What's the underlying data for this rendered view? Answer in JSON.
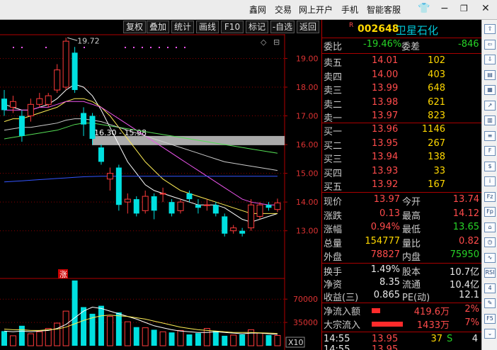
{
  "menu": {
    "items": [
      "鑫网",
      "交易",
      "网上开户",
      "手机",
      "智能客服"
    ],
    "win_controls": [
      "shirt-icon",
      "minimize-icon",
      "restore-icon",
      "close-icon"
    ]
  },
  "toolbar": {
    "buttons": [
      "复权",
      "叠加",
      "统计",
      "画线",
      "F10",
      "标记",
      "-自选",
      "返回"
    ]
  },
  "stock": {
    "flag": "R",
    "code": "002648",
    "name": "卫星石化"
  },
  "quote": {
    "weibi_label": "委比",
    "weibi_value": "-19.46%",
    "weicha_label": "委差",
    "weicha_value": "-846",
    "asks": [
      {
        "label": "卖五",
        "price": "14.01",
        "vol": "102"
      },
      {
        "label": "卖四",
        "price": "14.00",
        "vol": "403"
      },
      {
        "label": "卖三",
        "price": "13.99",
        "vol": "648"
      },
      {
        "label": "卖二",
        "price": "13.98",
        "vol": "621"
      },
      {
        "label": "卖一",
        "price": "13.97",
        "vol": "823"
      }
    ],
    "bids": [
      {
        "label": "买一",
        "price": "13.96",
        "vol": "1146"
      },
      {
        "label": "买二",
        "price": "13.95",
        "vol": "267"
      },
      {
        "label": "买三",
        "price": "13.94",
        "vol": "138"
      },
      {
        "label": "买四",
        "price": "13.93",
        "vol": "33"
      },
      {
        "label": "买五",
        "price": "13.92",
        "vol": "167"
      }
    ],
    "stats": [
      {
        "l1": "现价",
        "v1": "13.97",
        "l2": "今开",
        "v2": "13.74"
      },
      {
        "l1": "涨跌",
        "v1": "0.13",
        "l2": "最高",
        "v2": "14.12"
      },
      {
        "l1": "涨幅",
        "v1": "0.94%",
        "l2": "最低",
        "v2": "13.65"
      },
      {
        "l1": "总量",
        "v1": "154777",
        "l2": "量比",
        "v2": "0.82"
      },
      {
        "l1": "外盘",
        "v1": "78827",
        "l2": "内盘",
        "v2": "75950"
      }
    ],
    "finance": [
      {
        "l1": "换手",
        "v1": "1.49%",
        "l2": "股本",
        "v2": "10.7亿"
      },
      {
        "l1": "净资",
        "v1": "8.35",
        "l2": "流通",
        "v2": "10.4亿"
      },
      {
        "l1": "收益(三)",
        "v1": "0.865",
        "l2": "PE(动)",
        "v2": "12.1"
      }
    ],
    "flows": [
      {
        "label": "净流入额",
        "amount": "419.6万",
        "pct": "2%",
        "bar": 0.15
      },
      {
        "label": "大宗流入",
        "amount": "1433万",
        "pct": "7%",
        "bar": 0.55
      }
    ],
    "ticks": [
      {
        "time": "14:55",
        "price": "13.95",
        "vol": "37",
        "dir": "S",
        "count": "4"
      },
      {
        "time": "14:55",
        "price": "13.95",
        "vol": "",
        "dir": "",
        "count": ""
      }
    ]
  },
  "chart_data": {
    "type": "candlestick",
    "y_ticks": [
      "19.00",
      "18.00",
      "17.00",
      "16.00",
      "15.00",
      "14.00",
      "13.00"
    ],
    "ylim": [
      12.45,
      19.85
    ],
    "annotations": {
      "high_marker": "19.72",
      "range_label": "16.30 - 15.98",
      "zhang_mark": "涨"
    },
    "candles": [
      {
        "o": 17.6,
        "c": 17.2,
        "h": 17.9,
        "l": 17.0
      },
      {
        "o": 17.3,
        "c": 17.5,
        "h": 17.7,
        "l": 17.1
      },
      {
        "o": 17.0,
        "c": 16.3,
        "h": 17.2,
        "l": 16.1
      },
      {
        "o": 17.0,
        "c": 17.4,
        "h": 17.6,
        "l": 16.8
      },
      {
        "o": 17.4,
        "c": 17.6,
        "h": 17.8,
        "l": 17.3
      },
      {
        "o": 17.4,
        "c": 17.7,
        "h": 17.8,
        "l": 17.3
      },
      {
        "o": 17.9,
        "c": 18.6,
        "h": 18.8,
        "l": 17.8
      },
      {
        "o": 18.0,
        "c": 19.6,
        "h": 19.72,
        "l": 17.9
      },
      {
        "o": 19.2,
        "c": 17.9,
        "h": 19.4,
        "l": 17.8
      },
      {
        "o": 17.1,
        "c": 16.7,
        "h": 17.3,
        "l": 16.3
      },
      {
        "o": 17.0,
        "c": 16.2,
        "h": 17.1,
        "l": 16.0
      },
      {
        "o": 15.9,
        "c": 15.4,
        "h": 16.0,
        "l": 15.3
      },
      {
        "o": 14.8,
        "c": 15.0,
        "h": 15.2,
        "l": 14.4
      },
      {
        "o": 15.2,
        "c": 13.9,
        "h": 15.3,
        "l": 13.7
      },
      {
        "o": 14.0,
        "c": 14.1,
        "h": 14.3,
        "l": 13.6
      },
      {
        "o": 14.1,
        "c": 13.6,
        "h": 14.2,
        "l": 13.5
      },
      {
        "o": 13.7,
        "c": 14.2,
        "h": 14.4,
        "l": 13.6
      },
      {
        "o": 14.2,
        "c": 13.7,
        "h": 14.3,
        "l": 13.4
      },
      {
        "o": 14.3,
        "c": 14.3,
        "h": 14.5,
        "l": 14.0
      },
      {
        "o": 14.0,
        "c": 13.6,
        "h": 14.1,
        "l": 13.5
      },
      {
        "o": 13.7,
        "c": 14.0,
        "h": 14.1,
        "l": 13.6
      },
      {
        "o": 14.3,
        "c": 14.1,
        "h": 14.4,
        "l": 14.0
      },
      {
        "o": 13.9,
        "c": 13.8,
        "h": 14.1,
        "l": 13.6
      },
      {
        "o": 13.9,
        "c": 13.9,
        "h": 14.1,
        "l": 13.7
      },
      {
        "o": 13.9,
        "c": 13.6,
        "h": 14.0,
        "l": 13.5
      },
      {
        "o": 13.5,
        "c": 12.9,
        "h": 13.6,
        "l": 12.8
      },
      {
        "o": 13.0,
        "c": 13.1,
        "h": 13.2,
        "l": 12.9
      },
      {
        "o": 13.0,
        "c": 12.9,
        "h": 13.1,
        "l": 12.8
      },
      {
        "o": 13.1,
        "c": 13.9,
        "h": 14.1,
        "l": 13.0
      },
      {
        "o": 13.5,
        "c": 13.9,
        "h": 14.0,
        "l": 13.4
      },
      {
        "o": 13.9,
        "c": 13.8,
        "h": 14.0,
        "l": 13.7
      },
      {
        "o": 13.74,
        "c": 13.97,
        "h": 14.12,
        "l": 13.65
      }
    ],
    "ma_lines": [
      {
        "color": "#ffffff",
        "values": [
          17.4,
          17.3,
          17.2,
          17.2,
          17.3,
          17.4,
          17.6,
          17.9,
          18.1,
          18.0,
          17.7,
          17.2,
          16.6,
          16.0,
          15.4,
          15.0,
          14.6,
          14.4,
          14.3,
          14.2,
          14.1,
          14.0,
          13.9,
          13.9,
          13.9,
          13.8,
          13.6,
          13.4,
          13.3,
          13.4,
          13.5,
          13.6
        ]
      },
      {
        "color": "#ffee55",
        "values": [
          16.8,
          16.9,
          16.9,
          17.0,
          17.1,
          17.2,
          17.3,
          17.5,
          17.6,
          17.6,
          17.5,
          17.3,
          17.0,
          16.6,
          16.2,
          15.8,
          15.4,
          15.1,
          14.8,
          14.6,
          14.4,
          14.3,
          14.2,
          14.1,
          14.0,
          13.9,
          13.8,
          13.7,
          13.6,
          13.6,
          13.6,
          13.6
        ]
      },
      {
        "color": "#ee55ee",
        "values": [
          17.2,
          17.2,
          17.2,
          17.2,
          17.3,
          17.3,
          17.4,
          17.5,
          17.5,
          17.5,
          17.4,
          17.3,
          17.1,
          16.9,
          16.7,
          16.5,
          16.3,
          16.1,
          15.9,
          15.7,
          15.5,
          15.3,
          15.1,
          14.9,
          14.7,
          14.5,
          14.3,
          14.1,
          14.0,
          13.95,
          13.9,
          13.9
        ]
      },
      {
        "color": "#55dd55",
        "values": [
          16.2,
          16.25,
          16.3,
          16.35,
          16.4,
          16.45,
          16.5,
          16.6,
          16.7,
          16.75,
          16.75,
          16.7,
          16.65,
          16.6,
          16.55,
          16.5,
          16.45,
          16.4,
          16.35,
          16.3,
          16.25,
          16.2,
          16.15,
          16.1,
          16.05,
          16.0,
          15.95,
          15.9,
          15.85,
          15.8,
          15.75,
          15.7
        ]
      },
      {
        "color": "#cccccc",
        "values": [
          16.5,
          16.55,
          16.6,
          16.6,
          16.65,
          16.7,
          16.75,
          16.85,
          16.9,
          16.9,
          16.85,
          16.8,
          16.7,
          16.6,
          16.5,
          16.4,
          16.3,
          16.2,
          16.1,
          16.0,
          15.9,
          15.8,
          15.7,
          15.6,
          15.5,
          15.4,
          15.35,
          15.3,
          15.25,
          15.2,
          15.15,
          15.1
        ]
      },
      {
        "color": "#3355ff",
        "values": [
          14.7,
          14.72,
          14.74,
          14.76,
          14.78,
          14.8,
          14.82,
          14.84,
          14.86,
          14.88,
          14.89,
          14.9,
          14.9,
          14.9,
          14.9,
          14.9,
          14.9,
          14.9,
          14.9,
          14.9,
          14.9,
          14.9,
          14.9,
          14.9,
          14.9,
          14.9,
          14.9,
          14.9,
          14.9,
          14.9,
          14.9,
          14.9
        ]
      }
    ],
    "volume": {
      "y_ticks": [
        "70000",
        "35000"
      ],
      "ylim": [
        0,
        100000
      ],
      "axis_label": "X10",
      "bars": [
        22000,
        15000,
        30000,
        18000,
        21000,
        26000,
        34000,
        52000,
        98000,
        58000,
        48000,
        60000,
        44000,
        50000,
        36000,
        28000,
        27000,
        24000,
        21000,
        20000,
        23000,
        17000,
        19000,
        26000,
        22000,
        15000,
        16000,
        17000,
        24000,
        19000,
        16000,
        15500
      ],
      "ma": [
        {
          "color": "#ffffff",
          "values": [
            22000,
            21000,
            22000,
            21000,
            22000,
            23000,
            26000,
            32000,
            42000,
            52000,
            58000,
            56000,
            52000,
            48000,
            44000,
            40000,
            35000,
            30000,
            27000,
            24000,
            22000,
            21000,
            20000,
            20000,
            21000,
            20000,
            19000,
            18000,
            19000,
            19000,
            18000,
            17000
          ]
        },
        {
          "color": "#ffee55",
          "values": [
            25000,
            24000,
            24000,
            23000,
            23000,
            24000,
            25000,
            28000,
            33000,
            38000,
            42000,
            45000,
            46000,
            45000,
            44000,
            42000,
            40000,
            37000,
            34000,
            31000,
            28000,
            26000,
            24000,
            23000,
            22000,
            21000,
            20000,
            20000,
            20000,
            19500,
            19000,
            18500
          ]
        }
      ]
    }
  },
  "side_icons": [
    "up-arrow-icon",
    "left-arrow-icon",
    "down-arrow-icon",
    "report-icon",
    "grid-icon",
    "trend-icon",
    "bar-icon",
    "list-icon",
    "f10-icon",
    "dividend-icon",
    "info-icon",
    "fz-icon",
    "fp-icon",
    "bank-icon",
    "clock-icon",
    "wave-icon",
    "rsi-icon",
    "number-icon",
    "tools-icon",
    "f5-icon",
    "more-icon"
  ],
  "colors": {
    "up": "#ff3b3b",
    "down": "#00e0e0",
    "grid": "#8a0000",
    "axis": "#b00000",
    "band": "#aaaaaa"
  }
}
